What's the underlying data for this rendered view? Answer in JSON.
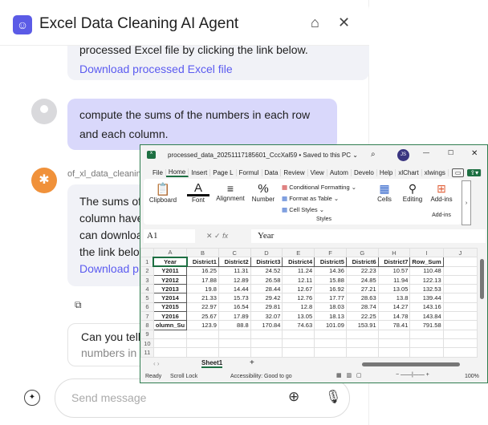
{
  "header": {
    "title": "Excel Data Cleaning AI Agent",
    "icons": [
      "robot-logo-icon",
      "clear-brush-icon",
      "close-icon"
    ]
  },
  "messages": {
    "m1_text": "processed Excel file by clicking the link below.",
    "m1_link": "Download processed Excel file",
    "user_text": "compute the sums of the numbers in each row and each column.",
    "bot_name": "of_xl_data_cleaning",
    "bot_lines": [
      "The sums of",
      "column have",
      "can downloa",
      "the link belo"
    ],
    "bot_link": "Download p",
    "suggestion": "Can you tell",
    "suggestion2": "numbers in"
  },
  "input": {
    "placeholder": "Send message"
  },
  "excel": {
    "title": "processed_data_20251117185601_CccXal59 • Saved to this PC ⌄",
    "user_initials": "JS",
    "tabs": [
      "File",
      "Home",
      "Insert",
      "Page L",
      "Formul",
      "Data",
      "Review",
      "View",
      "Autom",
      "Develo",
      "Help",
      "xlChart",
      "xlwings"
    ],
    "ribbon": {
      "clipboard": "Clipboard",
      "font": "Font",
      "alignment": "Alignment",
      "number": "Number",
      "cond": "Conditional Formatting ⌄",
      "fmt_table": "Format as Table ⌄",
      "cell_styles": "Cell Styles ⌄",
      "styles": "Styles",
      "cells": "Cells",
      "editing": "Editing",
      "addins": "Add-ins",
      "addins_group": "Add-ins"
    },
    "name_box": "A1",
    "formula": "Year",
    "columns": [
      "A",
      "B",
      "C",
      "D",
      "E",
      "F",
      "G",
      "H",
      "I",
      "J"
    ],
    "rows": [
      [
        "Year",
        "District1",
        "District2",
        "District3",
        "District4",
        "District5",
        "District6",
        "District7",
        "Row_Sum"
      ],
      [
        "Y2011",
        "16.25",
        "11.31",
        "24.52",
        "11.24",
        "14.36",
        "22.23",
        "10.57",
        "110.48"
      ],
      [
        "Y2012",
        "17.88",
        "12.89",
        "26.58",
        "12.11",
        "15.88",
        "24.85",
        "11.94",
        "122.13"
      ],
      [
        "Y2013",
        "19.8",
        "14.44",
        "28.44",
        "12.67",
        "16.92",
        "27.21",
        "13.05",
        "132.53"
      ],
      [
        "Y2014",
        "21.33",
        "15.73",
        "29.42",
        "12.76",
        "17.77",
        "28.63",
        "13.8",
        "139.44"
      ],
      [
        "Y2015",
        "22.97",
        "16.54",
        "29.81",
        "12.8",
        "18.03",
        "28.74",
        "14.27",
        "143.16"
      ],
      [
        "Y2016",
        "25.67",
        "17.89",
        "32.07",
        "13.05",
        "18.13",
        "22.25",
        "14.78",
        "143.84"
      ],
      [
        "olumn_Su",
        "123.9",
        "88.8",
        "170.84",
        "74.63",
        "101.09",
        "153.91",
        "78.41",
        "791.58"
      ]
    ],
    "sheet": "Sheet1",
    "status": {
      "ready": "Ready",
      "scroll": "Scroll Lock",
      "access": "Accessibility: Good to go",
      "zoom": "100%"
    }
  }
}
